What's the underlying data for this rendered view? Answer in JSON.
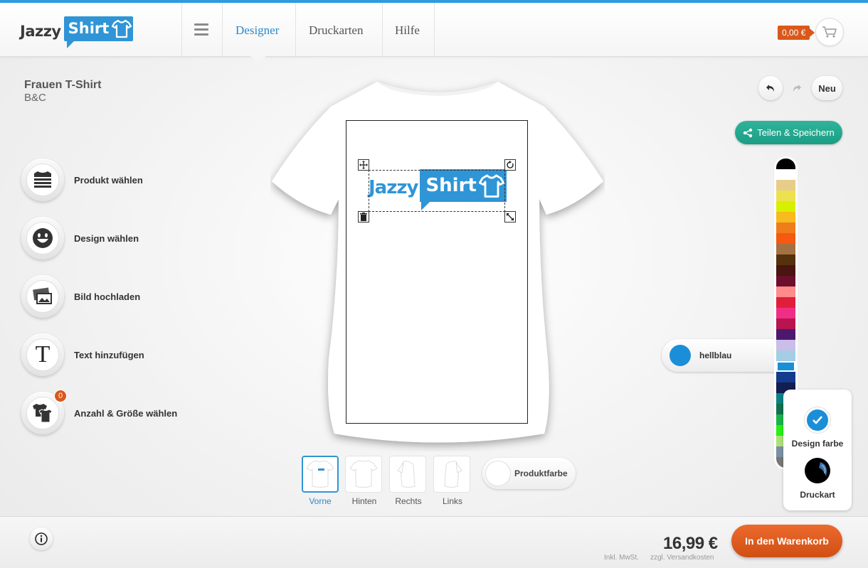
{
  "header": {
    "logo_part1": "Jazzy",
    "logo_part2": "Shirt",
    "nav": [
      {
        "label": "Designer",
        "active": true
      },
      {
        "label": "Druckarten",
        "active": false
      },
      {
        "label": "Hilfe",
        "active": false
      }
    ],
    "cart_total": "0,00 €",
    "icons": [
      "menu-icon",
      "cart-icon"
    ]
  },
  "product": {
    "title": "Frauen T-Shirt",
    "brand": "B&C"
  },
  "tools": [
    {
      "label": "Produkt wählen",
      "icon": "shirt-stack-icon"
    },
    {
      "label": "Design wählen",
      "icon": "smiley-icon"
    },
    {
      "label": "Bild hochladen",
      "icon": "image-upload-icon"
    },
    {
      "label": "Text hinzufügen",
      "icon": "text-icon"
    },
    {
      "label": "Anzahl & Größe wählen",
      "icon": "shirts-icon",
      "badge": "0"
    }
  ],
  "controls": {
    "new_label": "Neu",
    "share_label": "Teilen & Speichern"
  },
  "design": {
    "text_part1": "Jazzy",
    "text_part2": "Shirt",
    "color_name": "hellblau",
    "color_hex": "#1a8fd8"
  },
  "views": [
    {
      "label": "Vorne",
      "active": true
    },
    {
      "label": "Hinten",
      "active": false
    },
    {
      "label": "Rechts",
      "active": false
    },
    {
      "label": "Links",
      "active": false
    }
  ],
  "product_color_label": "Produktfarbe",
  "palette": [
    "#000000",
    "#ffffff",
    "#e8cc8a",
    "#ede14f",
    "#d8f000",
    "#f8ba1c",
    "#ef7d1a",
    "#f55a10",
    "#a57140",
    "#55310e",
    "#4a1410",
    "#6b0f2c",
    "#ff8b8b",
    "#e01e3c",
    "#f12e86",
    "#b8144f",
    "#4b186d",
    "#cabde8",
    "#a4cde6",
    "#1a8fd8",
    "#143a8c",
    "#121d52",
    "#0a8284",
    "#12704e",
    "#1ab34a",
    "#26f014",
    "#aee079",
    "#7a8fa3",
    "#777777",
    "#8a7a3a",
    "#6ec41c"
  ],
  "design_panel": {
    "design_color_label": "Design farbe",
    "print_type_label": "Druckart"
  },
  "footer": {
    "price": "16,99 €",
    "tax_note": "Inkl. MwSt.",
    "shipping_note": "zzgl. Versandkosten",
    "cta_label": "In den Warenkorb"
  }
}
